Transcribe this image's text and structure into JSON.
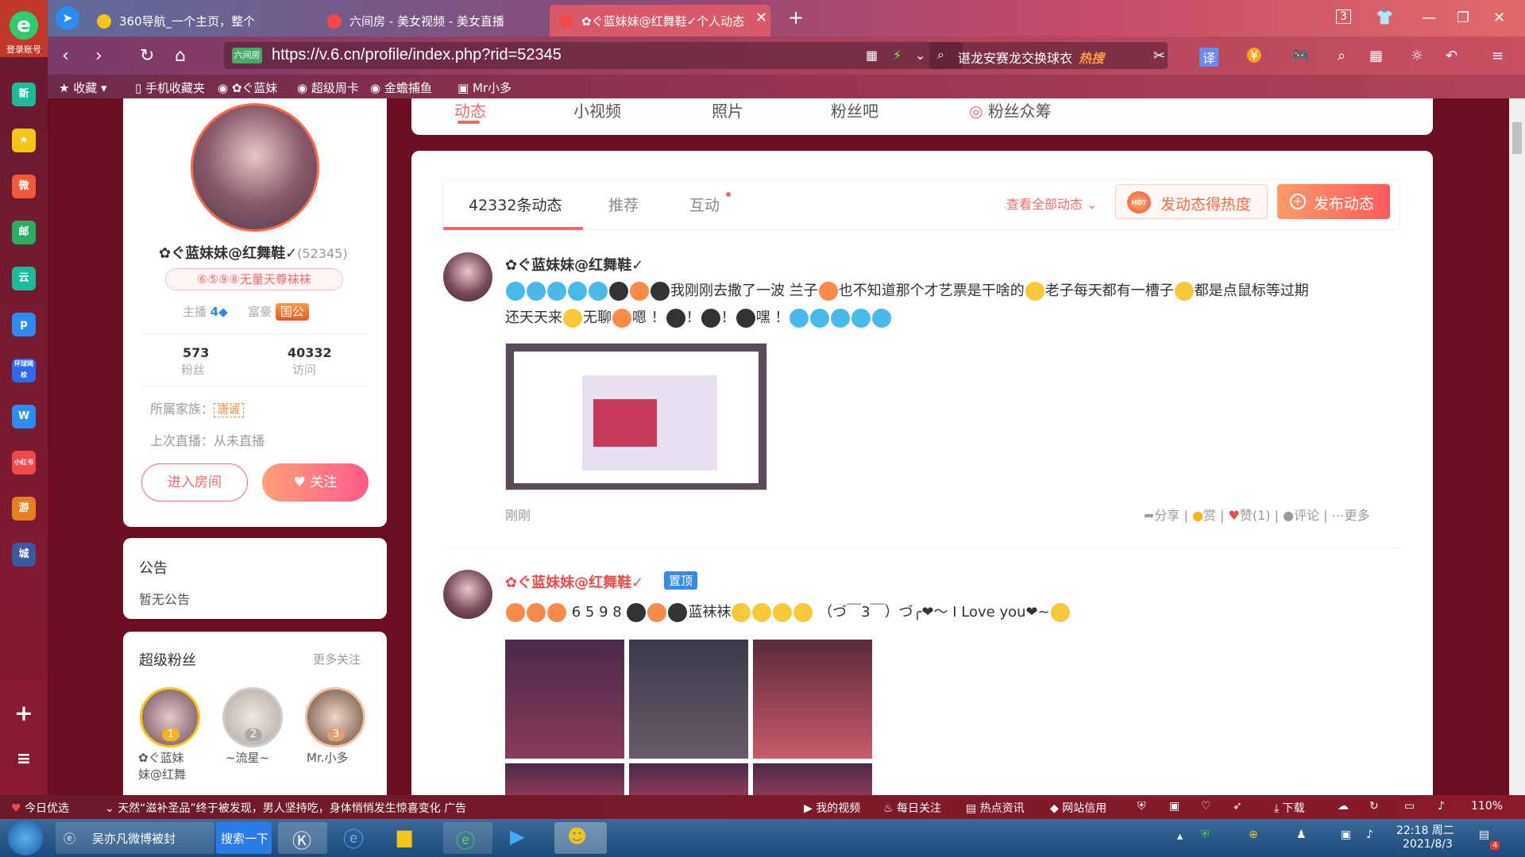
{
  "browser": {
    "logo_label": "登录账号",
    "tabs": [
      {
        "label": "360导航_一个主页，整个世界",
        "icon_color": "#f5c518"
      },
      {
        "label": "六间房 - 美女视频 - 美女直播",
        "icon_color": "#f04a4a"
      },
      {
        "label": "✿ぐ蓝妹妹@红舞鞋✓个人动态",
        "icon_color": "#f04a4a"
      }
    ],
    "tab_count": "3",
    "url": "https://v.6.cn/profile/index.php?rid=52345",
    "url_badge": "六间房",
    "search_text": "谌龙安赛龙交换球衣",
    "search_hot": "热搜",
    "bookmarks": [
      "收藏",
      "手机收藏夹",
      "✿ぐ蓝妹",
      "超级周卡",
      "金蟾捕鱼",
      "Mr小多"
    ]
  },
  "sidebar_icons": [
    "新",
    "★",
    "微",
    "邮",
    "云",
    "p",
    "环球网校",
    "W",
    "小红书",
    "游",
    "城"
  ],
  "profile": {
    "name": "✿ぐ蓝妹妹@红舞鞋✓",
    "rid": "(52345)",
    "medal": "⑥⑤⑨⑧无量天尊袜袜",
    "anchor_label": "主播",
    "anchor_level": "4",
    "wealth_label": "富豪",
    "wealth_badge": "国公",
    "fans_count": "573",
    "fans_label": "粉丝",
    "visits_count": "40332",
    "visits_label": "访问",
    "family_label": "所属家族：",
    "family_tag": "唐诚",
    "last_live": "上次直播：从未直播",
    "enter_room": "进入房间",
    "follow": "关注"
  },
  "notice": {
    "title": "公告",
    "body": "暂无公告"
  },
  "super_fans": {
    "title": "超级粉丝",
    "more": "更多关注",
    "fans": [
      {
        "rank": "1",
        "name": "✿ぐ蓝妹",
        "name2": "妹@红舞"
      },
      {
        "rank": "2",
        "name": "~流星~"
      },
      {
        "rank": "3",
        "name": "Mr.小多"
      }
    ]
  },
  "top_tabs": [
    "动态",
    "小视频",
    "照片",
    "粉丝吧",
    "粉丝众筹"
  ],
  "feed": {
    "tabs": [
      "42332条动态",
      "推荐",
      "互动"
    ],
    "view_all": "查看全部动态",
    "hot_btn": "发动态得热度",
    "hot_icon": "HOT",
    "post_btn": "发布动态",
    "posts": [
      {
        "author": "✿ぐ蓝妹妹@红舞鞋✓",
        "text1": "我刚刚去撒了一波 兰子",
        "text2": "也不知道那个才艺票是干啥的",
        "text3": "老子每天都有一槽子",
        "text4": "都是点鼠标等过期",
        "text5": "还天天来",
        "text6": "无聊",
        "text7": "嗯 ！",
        "text8": "！",
        "text9": "！",
        "text10": "嘿 ！",
        "time": "刚刚",
        "share": "分享",
        "reward": "赏",
        "likes": "赞(1)",
        "comment": "评论",
        "more": "更多"
      },
      {
        "author": "✿ぐ蓝妹妹@红舞鞋✓",
        "pinned": "置顶",
        "text": "6  5  9  8",
        "text2": "蓝袜袜",
        "text3": "（づ￣3￣）づ╭❤～ I Love you❤~"
      }
    ]
  },
  "statusbar": {
    "left": "今日优选",
    "news": "天然“滋补圣品”终于被发现，男人坚持吃，身体悄悄发生惊喜变化",
    "ad": "广告",
    "items": [
      "我的视频",
      "每日关注",
      "热点资讯",
      "网站信用",
      "下载",
      "110%"
    ]
  },
  "taskbar": {
    "app1": "吴亦凡微博被封",
    "search_btn": "搜索一下",
    "time": "22:18 周二",
    "date": "2021/8/3",
    "notif": "4"
  }
}
